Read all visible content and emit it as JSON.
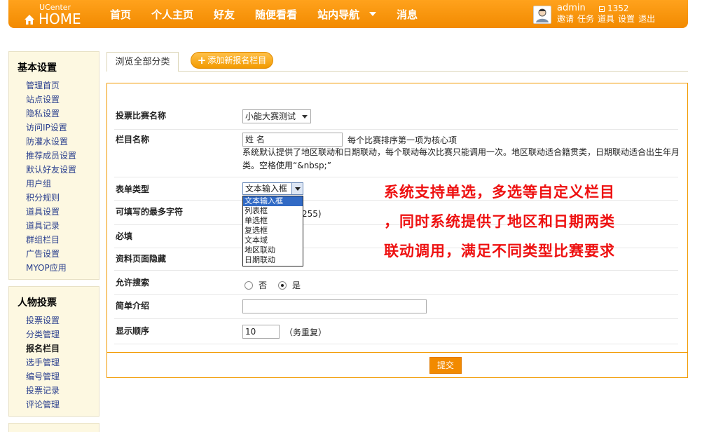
{
  "header": {
    "logo_small": "UCenter",
    "logo_big": "HOME",
    "nav": [
      "首页",
      "个人主页",
      "好友",
      "随便看看",
      "站内导航",
      "消息"
    ],
    "user": "admin",
    "coins": "1352",
    "user_links": [
      "邀请",
      "任务",
      "道具",
      "设置",
      "退出"
    ]
  },
  "sidebar": {
    "section1": {
      "title": "基本设置",
      "items": [
        "管理首页",
        "站点设置",
        "隐私设置",
        "访问IP设置",
        "防灌水设置",
        "推荐成员设置",
        "默认好友设置",
        "用户组",
        "积分规则",
        "道具设置",
        "道具记录",
        "群组栏目",
        "广告设置",
        "MYOP应用"
      ]
    },
    "section2": {
      "title": "人物投票",
      "items": [
        "投票设置",
        "分类管理",
        "报名栏目",
        "选手管理",
        "编号管理",
        "投票记录",
        "评论管理"
      ],
      "active_index": 2
    }
  },
  "tabs": {
    "browse": "浏览全部分类",
    "add": "添加新报名栏目"
  },
  "form": {
    "contest_label": "投票比赛名称",
    "contest_value": "小能大赛测试",
    "column_label": "栏目名称",
    "column_value": "姓  名",
    "column_note1": "每个比赛排序第一项为核心项",
    "column_note2": "系统默认提供了地区联动和日期联动，每个联动每次比赛只能调用一次。地区联动适合籍贯类，日期联动适合出生年月",
    "column_note3": "类。空格使用“&nbsp;”",
    "type_label": "表单类型",
    "type_value": "文本输入框",
    "type_options": [
      "文本输入框",
      "列表框",
      "单选框",
      "复选框",
      "文本域",
      "地区联动",
      "日期联动"
    ],
    "maxchars_label": "可填写的最多字符",
    "maxchars_hint": "255)",
    "required_label": "必填",
    "hidden_label": "资料页面隐藏",
    "search_label": "允许搜索",
    "search_no": "否",
    "search_yes": "是",
    "intro_label": "简单介绍",
    "order_label": "显示顺序",
    "order_value": "10",
    "order_hint": "（务重复）",
    "submit": "提交"
  },
  "overlay_text": [
    "系统支持单选，多选等自定义栏目",
    "，同时系统提供了地区和日期两类",
    "联动调用，满足不同类型比赛要求"
  ],
  "colors": {
    "brand": "#f28a00",
    "link": "#2a3f8e",
    "overlay": "#ee1111"
  }
}
